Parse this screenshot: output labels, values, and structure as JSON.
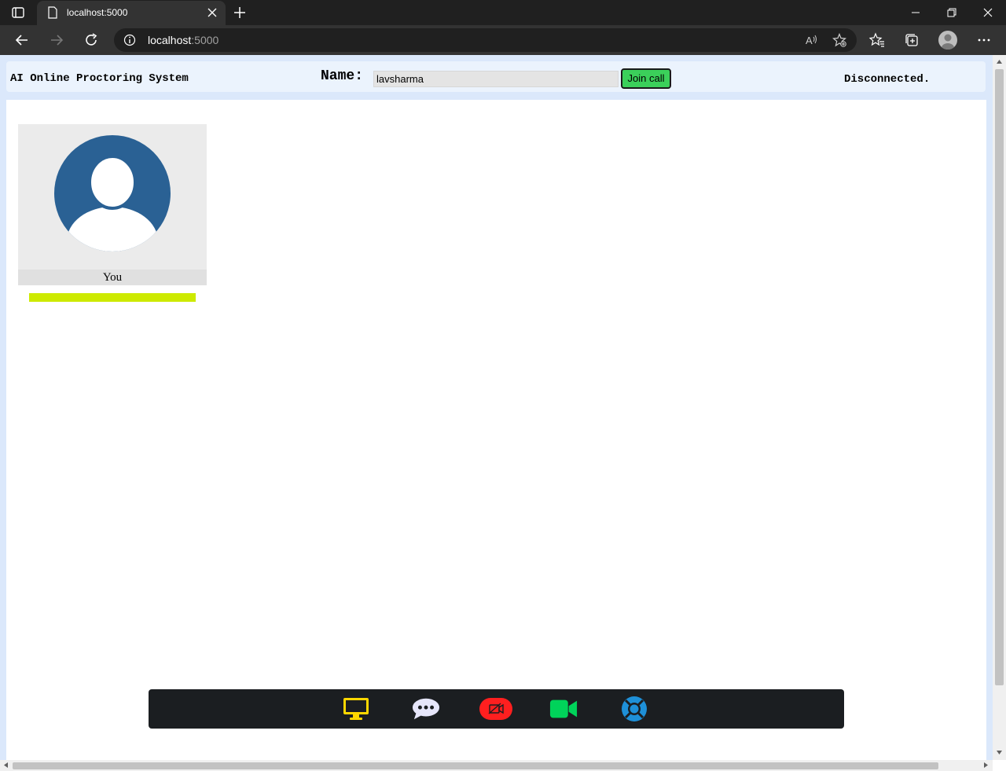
{
  "browser": {
    "tab_title": "localhost:5000",
    "url_host": "localhost",
    "url_port": ":5000"
  },
  "navbar": {
    "brand": "AI Online Proctoring System",
    "name_label": "Name:",
    "name_value": "lavsharma",
    "join_label": "Join call",
    "status": "Disconnected."
  },
  "video": {
    "label": "You",
    "audio_level": 1.0
  },
  "controls": [
    {
      "name": "screen-share-icon",
      "color": "#ffd700"
    },
    {
      "name": "chat-icon",
      "color": "#e6e6fa"
    },
    {
      "name": "camera-off-icon",
      "color": "#ff1f1f"
    },
    {
      "name": "camera-icon",
      "color": "#00d35a"
    },
    {
      "name": "help-icon",
      "color": "#1e90d8"
    }
  ]
}
